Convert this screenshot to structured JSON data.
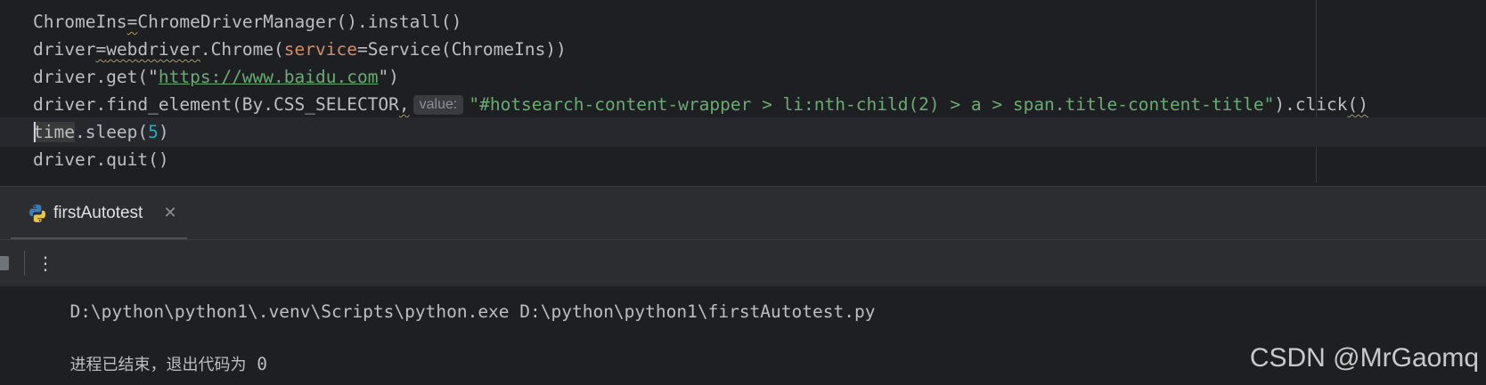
{
  "editor": {
    "lines": [
      {
        "a": "ChromeIns",
        "b": "=",
        "c": "ChromeDriverManager().install()"
      },
      {
        "a": "driver",
        "b": "=",
        "c": "webdriver",
        "d": ".Chrome(",
        "e": "service",
        "f": "=Service(ChromeIns))"
      },
      {
        "a": "driver.get(\"",
        "b": "https://www.baidu.com",
        "c": "\")"
      },
      {
        "a": "driver.find_element(By.CSS_SELECTOR",
        "b": ",",
        "hint": "value:",
        "c": "\"#hotsearch-content-wrapper > li:nth-child(2) > a > span.title-content-title\"",
        "d": ").click",
        "e": "()"
      },
      {
        "a": "time",
        "b": ".sleep(",
        "c": "5",
        "d": ")"
      },
      {
        "a": "driver.quit()"
      }
    ]
  },
  "run": {
    "tab_label": "firstAutotest",
    "close_glyph": "✕",
    "more_glyph": "⋮",
    "tab_icon": "python-icon"
  },
  "console": {
    "command": "D:\\python\\python1\\.venv\\Scripts\\python.exe D:\\python\\python1\\firstAutotest.py",
    "exit_text": "进程已结束，退出代码为",
    "exit_code": "0"
  },
  "watermark": "CSDN @MrGaomq",
  "colors": {
    "editor_bg": "#1e1f22",
    "panel_bg": "#2b2d30",
    "text": "#bcbec4",
    "string": "#6aab73",
    "keyword_arg": "#cf8e6d",
    "number": "#2aacb8"
  }
}
